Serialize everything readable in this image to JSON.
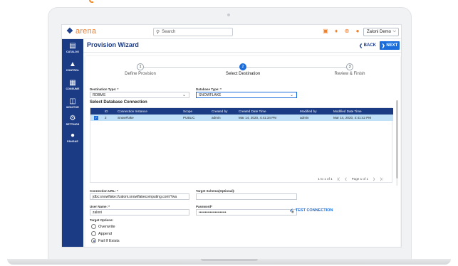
{
  "app": {
    "logo_text": "arena",
    "search_placeholder": "Search",
    "user_menu": "Zaloni Demo"
  },
  "top_icons": [
    "cart-icon",
    "bell-icon",
    "help-icon",
    "user-icon"
  ],
  "sidebar": {
    "items": [
      {
        "label": "CATALOG",
        "icon": "catalog-icon"
      },
      {
        "label": "CONTROL",
        "icon": "control-icon"
      },
      {
        "label": "CONSUME",
        "icon": "consume-icon"
      },
      {
        "label": "MONITOR",
        "icon": "monitor-icon"
      },
      {
        "label": "SETTINGS",
        "icon": "gear-icon"
      },
      {
        "label": "PANGAE",
        "icon": "chat-icon"
      }
    ]
  },
  "page": {
    "title": "Provision Wizard",
    "back_label": "BACK",
    "next_label": "NEXT"
  },
  "stepper": [
    {
      "number": "1",
      "label": "Define Provision",
      "active": false
    },
    {
      "number": "2",
      "label": "Select Destination",
      "active": true
    },
    {
      "number": "3",
      "label": "Review & Finish",
      "active": false
    }
  ],
  "form": {
    "destination_type_label": "Destination Type: *",
    "destination_type_value": "RDBMS",
    "database_type_label": "Database Type: *",
    "database_type_value": "SNOWFLAKE",
    "section_title": "Select Database Connection",
    "connection_url_label": "Connection URL: *",
    "connection_url_value": "jdbc:snowflake://zaloni.snowflakecomputing.com/?wa",
    "target_schema_label": "Target Schema(Optional):",
    "target_schema_value": "",
    "user_name_label": "User Name: *",
    "user_name_value": "zaloni",
    "password_label": "Password*",
    "password_value": "••••••••••••••••••••••",
    "test_connection_label": "TEST CONNECTION",
    "target_options_label": "Target Options:",
    "options": [
      {
        "label": "Overwrite",
        "selected": false
      },
      {
        "label": "Append",
        "selected": false
      },
      {
        "label": "Fail If Exists",
        "selected": true
      }
    ]
  },
  "table": {
    "columns": [
      "ID",
      "Connection Instance",
      "Scope",
      "Created by",
      "Created Date Time",
      "Modified by",
      "Modified Date Time"
    ],
    "rows": [
      {
        "id": "2",
        "instance": "SnowFlake",
        "scope": "PUBLIC",
        "created_by": "admin",
        "created_time": "Mar 14, 2020, 4:41:34 PM",
        "modified_by": "admin",
        "modified_time": "Mar 14, 2020, 4:41:42 PM"
      }
    ],
    "range_text": "1 to 1 of 1",
    "page_text": "Page 1 of 1"
  },
  "colors": {
    "brand_blue": "#1b3b85",
    "accent_blue": "#1a6ddb",
    "brand_orange": "#f07f2c",
    "selected_row": "#bfe0f6"
  }
}
